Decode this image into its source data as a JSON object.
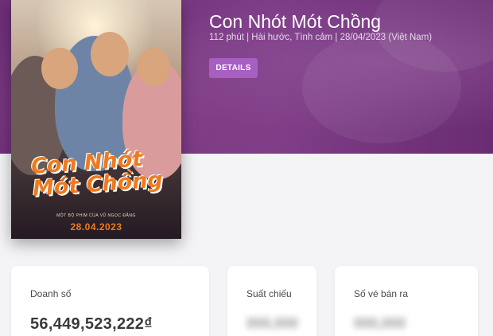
{
  "movie": {
    "title": "Con Nhót Mót Chồng",
    "meta": "112 phút  |  Hài hước, Tình cảm  |  28/04/2023 (Việt Nam)",
    "details_label": "DETAILS"
  },
  "poster": {
    "title_line1": "Con Nhót",
    "title_line2": "Mót Chồng",
    "credit": "MỘT BỘ PHIM CỦA VŨ NGỌC ĐÃNG",
    "date": "28.04.2023"
  },
  "stats": {
    "revenue_label": "Doanh số",
    "revenue_value": "56,449,523,222₫",
    "screenings_label": "Suất chiếu",
    "screenings_value": "000,000",
    "tickets_label": "Số vé bán ra",
    "tickets_value": "000,000"
  },
  "colors": {
    "hero_purple": "#7c3c86",
    "button_purple": "#a75fc1",
    "poster_orange": "#f07a1c"
  }
}
